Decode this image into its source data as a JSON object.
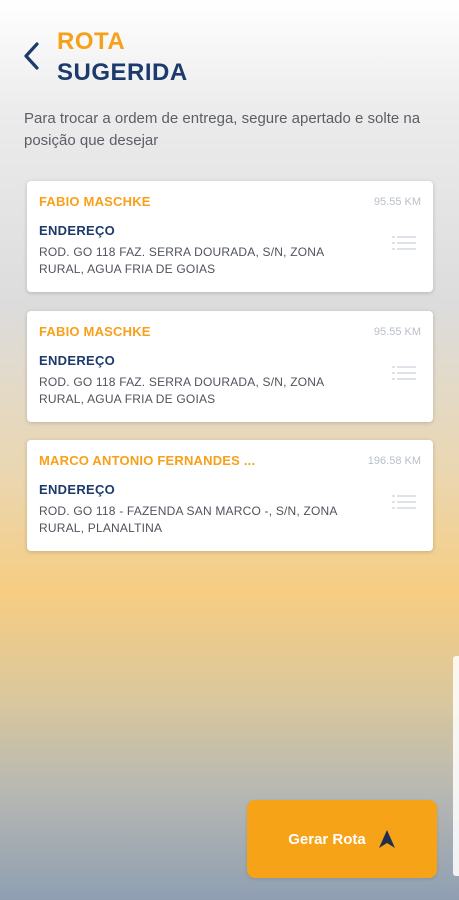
{
  "header": {
    "title_line1": "ROTA",
    "title_line2": "SUGERIDA",
    "back_icon": "chevron-left-icon"
  },
  "instructions": "Para trocar a ordem de entrega, segure apertado e solte na posição que desejar",
  "cards": [
    {
      "name": "FABIO MASCHKE",
      "distance": "95.55 KM",
      "label": "ENDEREÇO",
      "address": "ROD. GO 118 FAZ. SERRA DOURADA, S/N, ZONA RURAL, AGUA FRIA DE GOIAS"
    },
    {
      "name": "FABIO MASCHKE",
      "distance": "95.55 KM",
      "label": "ENDEREÇO",
      "address": "ROD. GO 118 FAZ. SERRA DOURADA, S/N, ZONA RURAL, AGUA FRIA DE GOIAS"
    },
    {
      "name": "MARCO ANTONIO FERNANDES ...",
      "distance": "196.58 KM",
      "label": "ENDEREÇO",
      "address": "ROD. GO 118 - FAZENDA SAN MARCO -, S/N, ZONA RURAL, PLANALTINA"
    }
  ],
  "action": {
    "label": "Gerar Rota",
    "icon": "navigation-arrow-icon"
  },
  "colors": {
    "accent": "#f7a019",
    "primary": "#1c3a6b"
  }
}
